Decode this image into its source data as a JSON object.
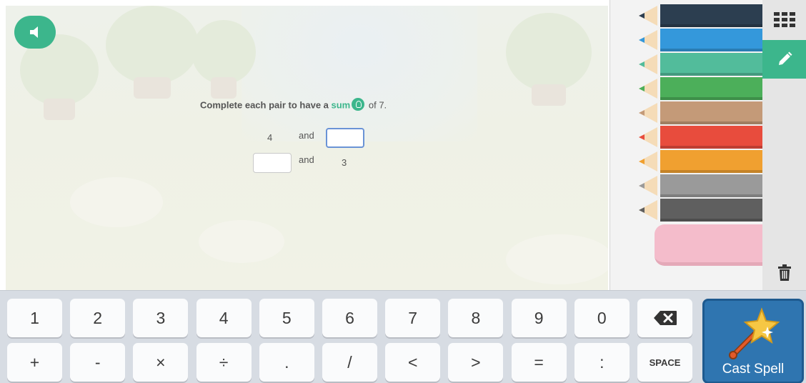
{
  "question": {
    "prefix": "Complete each pair to have a ",
    "keyword": "sum",
    "suffix": " of 7."
  },
  "pairs": [
    {
      "left": "4",
      "joiner": "and",
      "right": ""
    },
    {
      "left": "",
      "joiner": "and",
      "right": "3"
    }
  ],
  "pencils": [
    {
      "color": "#2c3e50"
    },
    {
      "color": "#3498db"
    },
    {
      "color": "#52bc9b"
    },
    {
      "color": "#4caf5a"
    },
    {
      "color": "#c49a78"
    },
    {
      "color": "#e84c3d"
    },
    {
      "color": "#f0a030"
    },
    {
      "color": "#9a9a9a"
    },
    {
      "color": "#5f5f5f"
    }
  ],
  "keyboard": {
    "row1": [
      "1",
      "2",
      "3",
      "4",
      "5",
      "6",
      "7",
      "8",
      "9",
      "0"
    ],
    "row2": [
      "+",
      "-",
      "×",
      "÷",
      ".",
      "/",
      "<",
      ">",
      "=",
      ":"
    ],
    "space_label": "SPACE",
    "cast_label": "Cast Spell"
  },
  "colors": {
    "accent": "#3cb68c",
    "cast_button": "#2f75b0",
    "eraser": "#f4bccb"
  },
  "icons": [
    "speaker-icon",
    "lightbulb-icon",
    "grid-icon",
    "pencil-icon",
    "trash-icon",
    "backspace-icon",
    "magic-wand-icon"
  ]
}
